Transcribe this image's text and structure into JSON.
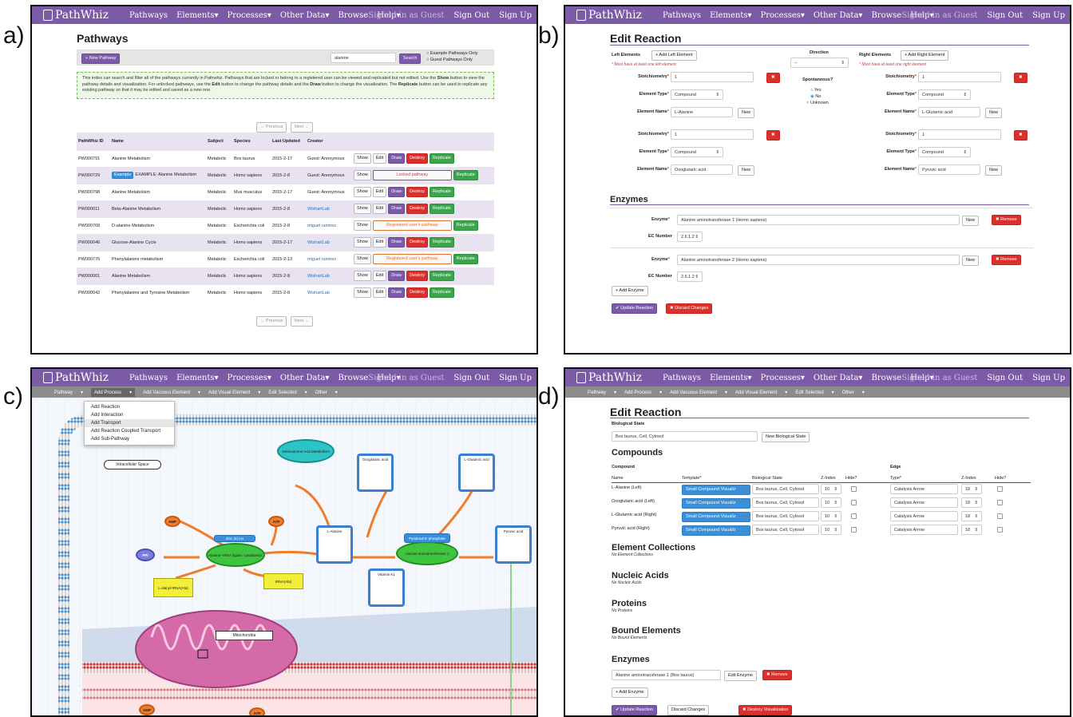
{
  "labels": {
    "a": "a)",
    "b": "b)",
    "c": "c)",
    "d": "d)"
  },
  "nav": {
    "logo": "PathWhiz",
    "items": [
      "Pathways",
      "Elements",
      "Processes",
      "Other Data",
      "Browse",
      "Help"
    ],
    "signed": "Signed in as Guest",
    "signout": "Sign Out",
    "signup": "Sign Up"
  },
  "panel_a": {
    "title": "Pathways",
    "new_btn": "+ New Pathway",
    "search_value": "alanine",
    "search_btn": "Search",
    "radio1": "Example Pathways Only",
    "radio2": "Guest Pathways Only",
    "info_pre": "This index can search and filter all of the pathways currently in Pathwhiz. Pathways that are locked or belong to a registered user can be viewed and replicated but not edited. Use the ",
    "info_show": "Show",
    "info_mid1": " button to view the pathway details and visualization. For unlocked pathways, use the ",
    "info_edit": "Edit",
    "info_mid2": " button to change the pathway details and the ",
    "info_draw": "Draw",
    "info_mid3": " button to change the visualization. The ",
    "info_rep": "Replicate",
    "info_end": " button can be used to replicate any existing pathway so that it may be edited and saved as a new one.",
    "prev": "← Previous",
    "next": "Next →",
    "headers": [
      "PathWhiz ID",
      "Name",
      "Subject",
      "Species",
      "Last Updated",
      "Creator"
    ],
    "rows": [
      {
        "id": "PW000791",
        "name": "Alanine Metabolism",
        "subject": "Metabolic",
        "species": "Bos taurus",
        "updated": "2015-2-17",
        "creator": "Guest: Anonymous",
        "actions": "full"
      },
      {
        "id": "PW000729",
        "badge": "Example",
        "name": "EXAMPLE: Alanine Metabolism",
        "subject": "Metabolic",
        "species": "Homo sapiens",
        "updated": "2015-2-8",
        "creator": "Guest: Anonymous",
        "actions": "locked"
      },
      {
        "id": "PW000798",
        "name": "Alanine Metabolism",
        "subject": "Metabolic",
        "species": "Mus musculus",
        "updated": "2015-2-17",
        "creator": "Guest: Anonymous",
        "actions": "full"
      },
      {
        "id": "PW000011",
        "name": "Beta-Alanine Metabolism",
        "subject": "Metabolic",
        "species": "Homo sapiens",
        "updated": "2015-2-8",
        "creator": "WishartLab",
        "actions": "full"
      },
      {
        "id": "PW000768",
        "name": "D-alanine Metabolism",
        "subject": "Metabolic",
        "species": "Escherichia coli",
        "updated": "2015-2-8",
        "creator": "miguel ramirez",
        "actions": "registered"
      },
      {
        "id": "PW000046",
        "name": "Glucose-Alanine Cycle",
        "subject": "Metabolic",
        "species": "Homo sapiens",
        "updated": "2015-2-17",
        "creator": "WishartLab",
        "actions": "full"
      },
      {
        "id": "PW000776",
        "name": "Phenylalanine metabolism",
        "subject": "Metabolic",
        "species": "Escherichia coli",
        "updated": "2015-2-13",
        "creator": "miguel ramirez",
        "actions": "registered"
      },
      {
        "id": "PW000001",
        "name": "Alanine Metabolism",
        "subject": "Metabolic",
        "species": "Homo sapiens",
        "updated": "2015-2-8",
        "creator": "WishartLab",
        "actions": "full"
      },
      {
        "id": "PW000042",
        "name": "Phenylalanine and Tyrosine Metabolism",
        "subject": "Metabolic",
        "species": "Homo sapiens",
        "updated": "2015-2-8",
        "creator": "WishartLab",
        "actions": "full"
      }
    ],
    "act": {
      "show": "Show",
      "edit": "Edit",
      "draw": "Draw",
      "destroy": "Destroy",
      "replicate": "Replicate",
      "locked": "Locked pathway",
      "registered": "Registered user's pathway"
    }
  },
  "panel_b": {
    "title": "Edit Reaction",
    "left_el": "Left Elements",
    "add_left": "+ Add Left Element",
    "must_left": "* Must have at least one left element",
    "direction": "Direction",
    "dir_value": "--",
    "right_el": "Right Elements",
    "add_right": "+ Add Right Element",
    "must_right": "* Must have at least one right element",
    "stoich": "Stoichiometry",
    "eltype": "Element Type",
    "elname": "Element Name",
    "new": "New",
    "spont": "Spontaneous?",
    "yes": "Yes",
    "no": "No",
    "unknown": "Unknown",
    "left": [
      {
        "stoich": "1",
        "type": "Compound",
        "name": "L-Alanine"
      },
      {
        "stoich": "1",
        "type": "Compound",
        "name": "Oxoglutaric acid"
      }
    ],
    "right": [
      {
        "stoich": "1",
        "type": "Compound",
        "name": "L-Glutamic acid"
      },
      {
        "stoich": "1",
        "type": "Compound",
        "name": "Pyruvic acid"
      }
    ],
    "enzymes": "Enzymes",
    "enzyme_lbl": "Enzyme",
    "ec_lbl": "EC Number",
    "remove": "✖ Remove",
    "enz": [
      {
        "name": "Alanine aminotransferase 1 (Homo sapiens)",
        "ec": "2.6.1.2"
      },
      {
        "name": "Alanine aminotransferase 2 (Homo sapiens)",
        "ec": "2.6.1.2"
      }
    ],
    "add_enzyme": "+ Add Enzyme",
    "update": "✔ Update Reaction",
    "discard": "✖ Discard Changes"
  },
  "panel_c": {
    "subnav": [
      "Pathway",
      "Add Process",
      "Add Vacuous Element",
      "Add Visual Element",
      "Edit Selected",
      "Other"
    ],
    "menu": [
      "Add Reaction",
      "Add Interaction",
      "Add Transport",
      "Add Reaction Coupled Transport",
      "Add Sub-Pathway"
    ],
    "intracellular": "Intracellular Space",
    "mito": "Mitochondria",
    "nodes": {
      "seleno": "Selenoamine Acid Metabolism",
      "oxo": "Oxoglutaric acid",
      "lglu": "L-Glutamic acid",
      "pyr": "Pyruvic acid",
      "lala": "L-Alanine",
      "zinc": "Zinc (II) ion",
      "alatrna": "Alanine--tRNA ligase, cytoplasmic",
      "plp": "Pyridoxal 5'-phosphate",
      "alat": "Alanine aminotransferase 1",
      "amp": "AMP",
      "atp": "ATP",
      "pp": "PPi",
      "lalanyl": "L-alanyl-tRNA(Ala)",
      "trna": "tRNA(Ala)",
      "vitk": "Vitamin K1"
    }
  },
  "panel_d": {
    "subnav": [
      "Pathway",
      "Add Process",
      "Add Vacuous Element",
      "Add Visual Element",
      "Edit Selected",
      "Other"
    ],
    "title": "Edit Reaction",
    "bio_state": "Biological State",
    "bio_value": "Bos taurus, Cell, Cytosol",
    "new_bio": "New Biological State",
    "compounds": "Compounds",
    "compound_hdr": "Compound",
    "edge_hdr": "Edge",
    "cols": [
      "Name",
      "Template*",
      "Biological State",
      "Z-Index",
      "Hide?",
      "Type*",
      "Z-Index",
      "Hide?"
    ],
    "rows": [
      {
        "name": "L-Alanine (Left)",
        "tpl": "Small Compound Visualiz",
        "bio": "Bos taurus, Cell, Cytosol",
        "z": "10",
        "etype": "Catalysis Arrow",
        "ez": "18"
      },
      {
        "name": "Oxoglutaric acid (Left)",
        "tpl": "Small Compound Visualiz",
        "bio": "Bos taurus, Cell, Cytosol",
        "z": "10",
        "etype": "Catalysis Arrow",
        "ez": "18"
      },
      {
        "name": "L-Glutamic acid (Right)",
        "tpl": "Small Compound Visualiz",
        "bio": "Bos taurus, Cell, Cytosol",
        "z": "10",
        "etype": "Catalysis Arrow",
        "ez": "18"
      },
      {
        "name": "Pyruvic acid (Right)",
        "tpl": "Small Compound Visualiz",
        "bio": "Bos taurus, Cell, Cytosol",
        "z": "10",
        "etype": "Catalysis Arrow",
        "ez": "18"
      }
    ],
    "ec": "Element Collections",
    "no_ec": "No Element Collections",
    "na": "Nucleic Acids",
    "no_na": "No Nucleic Acids",
    "prot": "Proteins",
    "no_prot": "No Proteins",
    "bound": "Bound Elements",
    "no_bound": "No Bound Elements",
    "enzymes": "Enzymes",
    "enz_value": "Alanine aminotransferase 1 (Bos taurus)",
    "edit_enz": "Edit Enzyme",
    "remove": "✖ Remove",
    "add_enzyme": "+ Add Enzyme",
    "update": "✔ Update Reaction",
    "discard": "Discard Changes",
    "destroy": "✖ Destroy Visualization"
  }
}
